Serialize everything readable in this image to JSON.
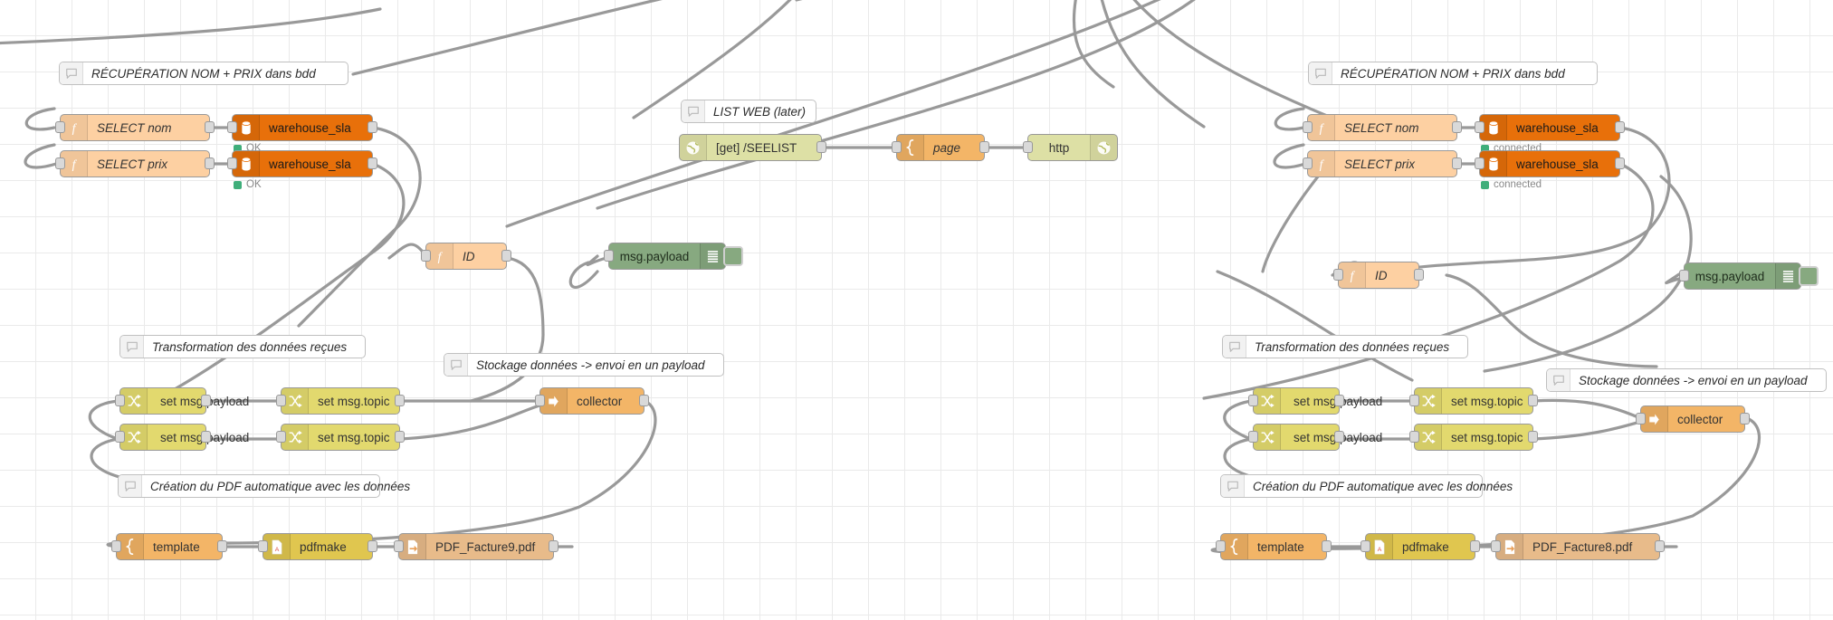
{
  "editor": {
    "app": "Node-RED flow editor canvas",
    "grid_color": "#eaeaea",
    "wire_color": "#999999"
  },
  "palette": {
    "function_color": "#fdd0a2",
    "database_color": "#e8700a",
    "change_color": "#e2d96e",
    "template_color": "#f3b567",
    "pdfmake_color": "#e0c64f",
    "file_color": "#e8bb8a",
    "http_color": "#dde0a5",
    "debug_color": "#87a980",
    "status_ok_color": "#3fae7a"
  },
  "flow_left": {
    "comments": {
      "db": "RÉCUPÉRATION NOM + PRIX dans bdd",
      "transform": "Transformation des données reçues",
      "storage": "Stockage données -> envoi en un payload",
      "pdf": "Création du PDF automatique avec les données"
    },
    "select_nom": "SELECT nom",
    "select_prix": "SELECT prix",
    "db_top": "warehouse_sla",
    "db_bottom": "warehouse_sla",
    "db_top_status": "OK",
    "db_bottom_status": "OK",
    "id_node": "ID",
    "debug_node": "msg.payload",
    "set_payload_1": "set msg.payload",
    "set_topic_1": "set msg.topic",
    "set_payload_2": "set msg.payload",
    "set_topic_2": "set msg.topic",
    "collector": "collector",
    "template": "template",
    "pdfmake": "pdfmake",
    "pdf_file": "PDF_Facture9.pdf"
  },
  "flow_center": {
    "comment": "LIST WEB (later)",
    "http_in": "[get] /SEELIST",
    "template": "page",
    "http_response": "http"
  },
  "flow_right": {
    "comments": {
      "db": "RÉCUPÉRATION NOM + PRIX dans bdd",
      "transform": "Transformation des données reçues",
      "storage": "Stockage données -> envoi en un payload",
      "pdf": "Création du PDF automatique avec les données"
    },
    "select_nom": "SELECT nom",
    "select_prix": "SELECT prix",
    "db_top": "warehouse_sla",
    "db_bottom": "warehouse_sla",
    "db_top_status": "connected",
    "db_bottom_status": "connected",
    "id_node": "ID",
    "debug_node": "msg.payload",
    "set_payload_1": "set msg.payload",
    "set_topic_1": "set msg.topic",
    "set_payload_2": "set msg.payload",
    "set_topic_2": "set msg.topic",
    "collector": "collector",
    "template": "template",
    "pdfmake": "pdfmake",
    "pdf_file": "PDF_Facture8.pdf"
  }
}
